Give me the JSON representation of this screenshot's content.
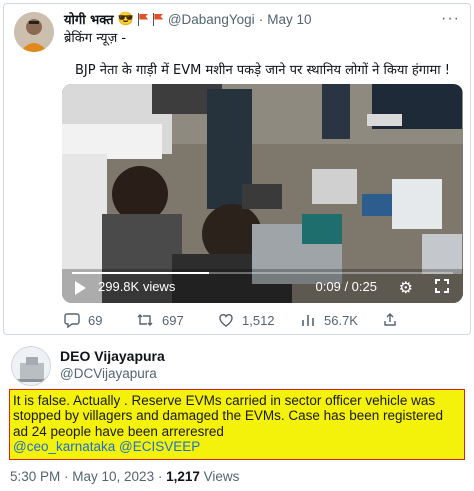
{
  "original_tweet": {
    "display_name": "योगी भक्त",
    "emoji": "😎",
    "handle": "@DabangYogi",
    "separator": "·",
    "date": "May 10",
    "more_label": "···",
    "tag_line": "ब्रेकिंग न्यूज़ -",
    "headline": "BJP नेता के गाड़ी में EVM मशीन पकड़े जाने पर स्थानिय लोगों ने किया हंगामा !",
    "video": {
      "views_label": "299.8K views",
      "time_label": "0:09 / 0:25",
      "progress_fraction": 0.36
    },
    "actions": {
      "replies": "69",
      "retweets": "697",
      "likes": "1,512",
      "views": "56.7K"
    }
  },
  "reply_tweet": {
    "display_name": "DEO Vijayapura",
    "handle": "@DCVijayapura",
    "text_line1": "It is false. Actually . Reserve EVMs  carried in sector officer  vehicle was",
    "text_line2": "stopped by villagers and damaged the EVMs. Case has been registered",
    "text_line3": "ad 24 people have been arreresred",
    "mentions": "@ceo_karnataka @ECISVEEP",
    "footer_time": "5:30 PM · May 10, 2023 · ",
    "footer_views_count": "1,217",
    "footer_views_label": " Views",
    "highlight_color": "#f4f10b",
    "border_color": "#e0201b"
  }
}
